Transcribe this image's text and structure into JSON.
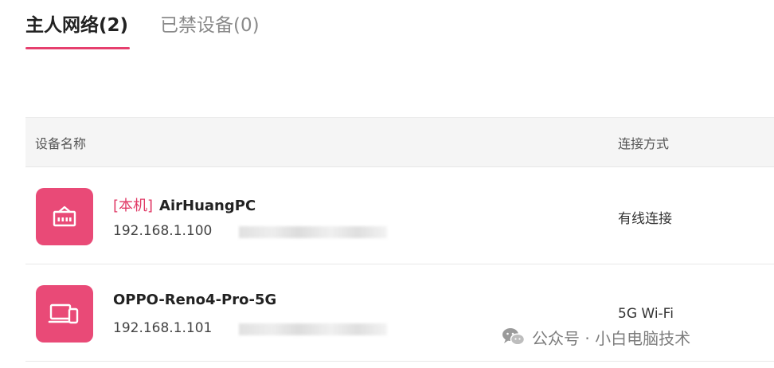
{
  "tabs": {
    "main_network": "主人网络(2)",
    "blocked_devices": "已禁设备(0)"
  },
  "table": {
    "headers": {
      "device_name": "设备名称",
      "connection": "连接方式"
    },
    "rows": [
      {
        "tag": "[本机]",
        "name": "AirHuangPC",
        "ip": "192.168.1.100",
        "connection": "有线连接",
        "icon": "ethernet-port-icon"
      },
      {
        "name": "OPPO-Reno4-Pro-5G",
        "ip": "192.168.1.101",
        "connection": "5G Wi-Fi",
        "icon": "devices-icon"
      }
    ]
  },
  "watermark": {
    "text": "公众号 · 小白电脑技术",
    "icon": "wechat-icon"
  },
  "colors": {
    "accent": "#e94a77",
    "tag": "#e03a66",
    "header_bg": "#f5f5f5"
  }
}
